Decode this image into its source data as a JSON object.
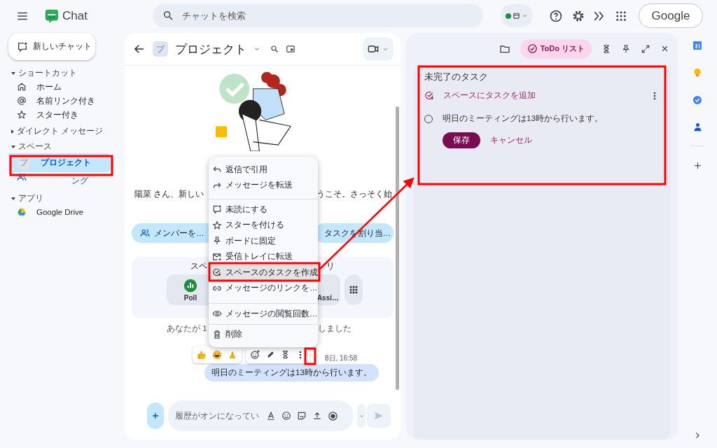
{
  "top_bar": {
    "app_name": "Chat",
    "search": {
      "placeholder": "チャットを検索"
    },
    "account_button": "Google"
  },
  "sidebar": {
    "new_chat_button": "新しいチャット",
    "sections": [
      {
        "title": "ショートカット",
        "expanded": true,
        "items": [
          {
            "kind": "home",
            "label": "ホーム",
            "selected": false
          },
          {
            "kind": "mention",
            "label": "名前リンク付き",
            "selected": false
          },
          {
            "kind": "star",
            "label": "スター付き",
            "selected": false
          }
        ]
      },
      {
        "title": "ダイレクト メッセージ",
        "expanded": false
      },
      {
        "title": "スペース",
        "expanded": true,
        "items": [
          {
            "kind": "space",
            "avatar": "プ",
            "label": "プロジェクト",
            "selected": true
          },
          {
            "kind": "browse",
            "label": "ング",
            "selected": false
          }
        ]
      },
      {
        "title": "アプリ",
        "expanded": true,
        "items": [
          {
            "kind": "app",
            "label": "Google Drive",
            "selected": false
          }
        ]
      }
    ]
  },
  "chat": {
    "header": {
      "avatar": "プ",
      "title": "プロジェクト"
    },
    "welcome": {
      "text_left": "陽菜 さん、新しい",
      "text_right": "うこそ。さっそく始"
    },
    "actions": [
      "メンバーを…",
      "タスクを割り当…"
    ],
    "apps_card": {
      "title_left": "スペ",
      "title_right": "リ",
      "apps": [
        {
          "label": "Poll"
        },
        {
          "label": "Assi…"
        }
      ]
    },
    "system_message": {
      "text_left": "あなたが 1",
      "text_right": "しました"
    },
    "message": {
      "time": "8日, 16:58",
      "text": "明日のミーティングは13時から行います。"
    },
    "composer": {
      "placeholder": "履歴がオンになってい"
    }
  },
  "context_menu": {
    "groups": [
      {
        "items": [
          {
            "kind": "reply",
            "label": "返信で引用",
            "selected": false
          },
          {
            "kind": "forward",
            "label": "メッセージを転送",
            "selected": false
          }
        ]
      },
      {
        "items": [
          {
            "kind": "unread",
            "label": "未読にする",
            "selected": false
          },
          {
            "kind": "star",
            "label": "スターを付ける",
            "selected": false
          },
          {
            "kind": "pin",
            "label": "ボードに固定",
            "selected": false
          },
          {
            "kind": "mail",
            "label": "受信トレイに転送",
            "selected": false
          },
          {
            "kind": "task",
            "label": "スペースのタスクを作成",
            "selected": true
          },
          {
            "kind": "link",
            "label": "メッセージのリンクを…",
            "selected": false
          }
        ]
      },
      {
        "items": [
          {
            "kind": "eye",
            "label": "メッセージの閲覧回数…",
            "selected": false
          }
        ]
      },
      {
        "items": [
          {
            "kind": "trash",
            "label": "削除",
            "selected": false
          }
        ]
      }
    ]
  },
  "tasks_panel": {
    "tabs": [
      {
        "label": "ToDo リスト",
        "selected": true
      }
    ],
    "title": "未完了のタスク",
    "add_task": "スペースにタスクを追加",
    "tasks": [
      {
        "text": "明日のミーティングは13時から行います。",
        "done": false
      }
    ],
    "save_button": "保存",
    "cancel_button": "キャンセル"
  }
}
